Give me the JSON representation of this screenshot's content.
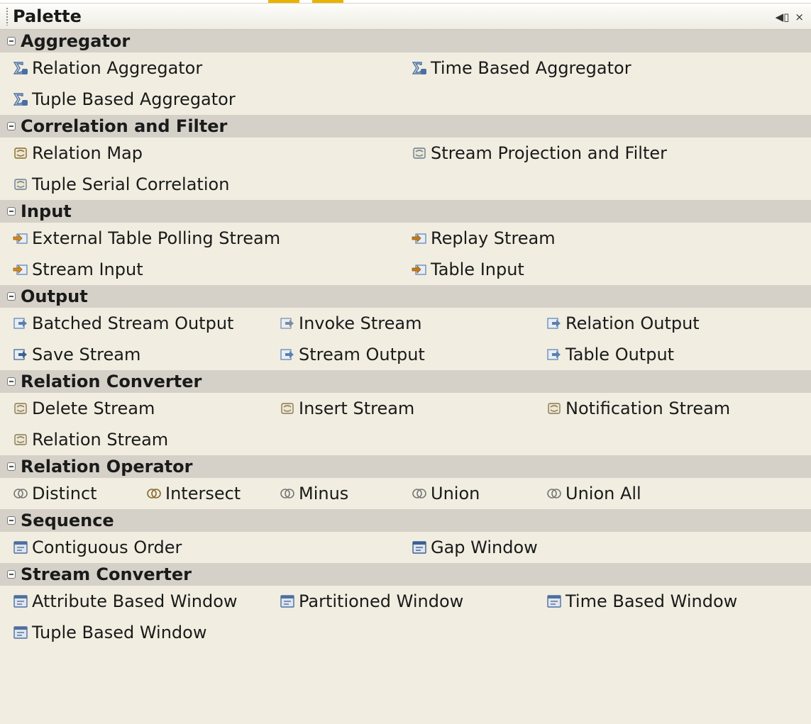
{
  "palette": {
    "title": "Palette",
    "buttons": {
      "minimize_label": "◀▯",
      "close_label": "×"
    },
    "categories": [
      {
        "name": "Aggregator",
        "rows": [
          [
            {
              "label": "Relation Aggregator",
              "icon": "sigma-relation-icon"
            },
            {
              "label": "Time Based Aggregator",
              "icon": "sigma-time-icon"
            }
          ],
          [
            {
              "label": "Tuple Based Aggregator",
              "icon": "sigma-tuple-icon"
            }
          ]
        ]
      },
      {
        "name": "Correlation and Filter",
        "rows": [
          [
            {
              "label": "Relation Map",
              "icon": "relation-map-icon"
            },
            {
              "label": "Stream Projection and Filter",
              "icon": "projection-filter-icon"
            }
          ],
          [
            {
              "label": "Tuple Serial Correlation",
              "icon": "serial-correlation-icon"
            }
          ]
        ]
      },
      {
        "name": "Input",
        "rows": [
          [
            {
              "label": "External Table Polling Stream",
              "icon": "polling-stream-icon"
            },
            {
              "label": "Replay Stream",
              "icon": "replay-stream-icon"
            }
          ],
          [
            {
              "label": "Stream Input",
              "icon": "stream-input-icon"
            },
            {
              "label": "Table Input",
              "icon": "table-input-icon"
            }
          ]
        ]
      },
      {
        "name": "Output",
        "rows": [
          [
            {
              "label": "Batched Stream Output",
              "icon": "batched-output-icon"
            },
            {
              "label": "Invoke Stream",
              "icon": "invoke-stream-icon"
            },
            {
              "label": "Relation Output",
              "icon": "relation-output-icon"
            }
          ],
          [
            {
              "label": "Save Stream",
              "icon": "save-stream-icon"
            },
            {
              "label": "Stream Output",
              "icon": "stream-output-icon"
            },
            {
              "label": "Table Output",
              "icon": "table-output-icon"
            }
          ]
        ]
      },
      {
        "name": "Relation Converter",
        "rows": [
          [
            {
              "label": "Delete Stream",
              "icon": "delete-stream-icon"
            },
            {
              "label": "Insert Stream",
              "icon": "insert-stream-icon"
            },
            {
              "label": "Notification Stream",
              "icon": "notification-stream-icon"
            }
          ],
          [
            {
              "label": "Relation Stream",
              "icon": "relation-stream-icon"
            }
          ]
        ]
      },
      {
        "name": "Relation Operator",
        "rows": [
          [
            {
              "label": "Distinct",
              "icon": "distinct-icon"
            },
            {
              "label": "Intersect",
              "icon": "intersect-icon"
            },
            {
              "label": "Minus",
              "icon": "minus-icon"
            },
            {
              "label": "Union",
              "icon": "union-icon"
            },
            {
              "label": "Union All",
              "icon": "union-all-icon"
            }
          ]
        ]
      },
      {
        "name": "Sequence",
        "rows": [
          [
            {
              "label": "Contiguous Order",
              "icon": "contiguous-order-icon"
            },
            {
              "label": "Gap Window",
              "icon": "gap-window-icon"
            }
          ]
        ]
      },
      {
        "name": "Stream Converter",
        "rows": [
          [
            {
              "label": "Attribute Based Window",
              "icon": "attribute-window-icon"
            },
            {
              "label": "Partitioned Window",
              "icon": "partitioned-window-icon"
            },
            {
              "label": "Time Based Window",
              "icon": "time-window-icon"
            }
          ],
          [
            {
              "label": "Tuple Based Window",
              "icon": "tuple-window-icon"
            }
          ]
        ]
      }
    ]
  },
  "colors": {
    "background": "#f1eee1",
    "category_header": "#d5d1c8",
    "accent": "#e8b400"
  }
}
